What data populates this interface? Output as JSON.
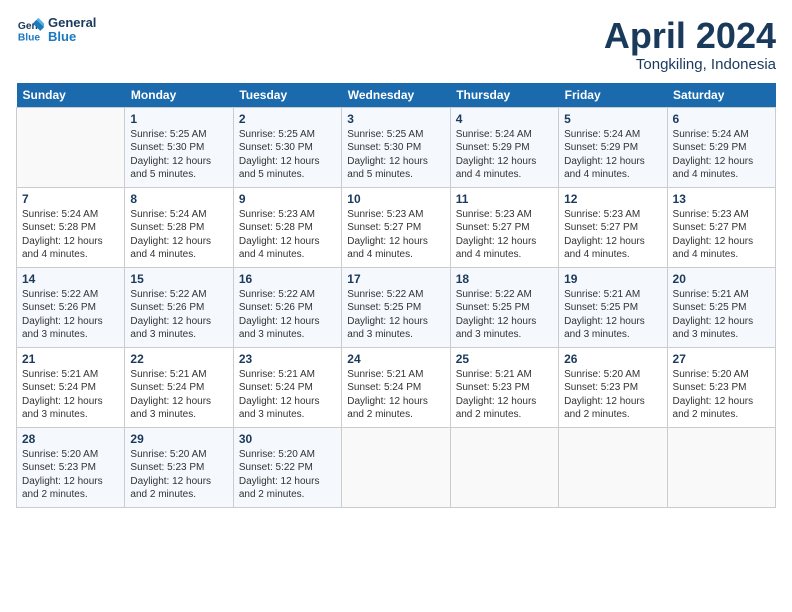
{
  "header": {
    "logo_line1": "General",
    "logo_line2": "Blue",
    "month_title": "April 2024",
    "location": "Tongkiling, Indonesia"
  },
  "days_of_week": [
    "Sunday",
    "Monday",
    "Tuesday",
    "Wednesday",
    "Thursday",
    "Friday",
    "Saturday"
  ],
  "weeks": [
    [
      {
        "day": "",
        "info": ""
      },
      {
        "day": "1",
        "info": "Sunrise: 5:25 AM\nSunset: 5:30 PM\nDaylight: 12 hours\nand 5 minutes."
      },
      {
        "day": "2",
        "info": "Sunrise: 5:25 AM\nSunset: 5:30 PM\nDaylight: 12 hours\nand 5 minutes."
      },
      {
        "day": "3",
        "info": "Sunrise: 5:25 AM\nSunset: 5:30 PM\nDaylight: 12 hours\nand 5 minutes."
      },
      {
        "day": "4",
        "info": "Sunrise: 5:24 AM\nSunset: 5:29 PM\nDaylight: 12 hours\nand 4 minutes."
      },
      {
        "day": "5",
        "info": "Sunrise: 5:24 AM\nSunset: 5:29 PM\nDaylight: 12 hours\nand 4 minutes."
      },
      {
        "day": "6",
        "info": "Sunrise: 5:24 AM\nSunset: 5:29 PM\nDaylight: 12 hours\nand 4 minutes."
      }
    ],
    [
      {
        "day": "7",
        "info": "Sunrise: 5:24 AM\nSunset: 5:28 PM\nDaylight: 12 hours\nand 4 minutes."
      },
      {
        "day": "8",
        "info": "Sunrise: 5:24 AM\nSunset: 5:28 PM\nDaylight: 12 hours\nand 4 minutes."
      },
      {
        "day": "9",
        "info": "Sunrise: 5:23 AM\nSunset: 5:28 PM\nDaylight: 12 hours\nand 4 minutes."
      },
      {
        "day": "10",
        "info": "Sunrise: 5:23 AM\nSunset: 5:27 PM\nDaylight: 12 hours\nand 4 minutes."
      },
      {
        "day": "11",
        "info": "Sunrise: 5:23 AM\nSunset: 5:27 PM\nDaylight: 12 hours\nand 4 minutes."
      },
      {
        "day": "12",
        "info": "Sunrise: 5:23 AM\nSunset: 5:27 PM\nDaylight: 12 hours\nand 4 minutes."
      },
      {
        "day": "13",
        "info": "Sunrise: 5:23 AM\nSunset: 5:27 PM\nDaylight: 12 hours\nand 4 minutes."
      }
    ],
    [
      {
        "day": "14",
        "info": "Sunrise: 5:22 AM\nSunset: 5:26 PM\nDaylight: 12 hours\nand 3 minutes."
      },
      {
        "day": "15",
        "info": "Sunrise: 5:22 AM\nSunset: 5:26 PM\nDaylight: 12 hours\nand 3 minutes."
      },
      {
        "day": "16",
        "info": "Sunrise: 5:22 AM\nSunset: 5:26 PM\nDaylight: 12 hours\nand 3 minutes."
      },
      {
        "day": "17",
        "info": "Sunrise: 5:22 AM\nSunset: 5:25 PM\nDaylight: 12 hours\nand 3 minutes."
      },
      {
        "day": "18",
        "info": "Sunrise: 5:22 AM\nSunset: 5:25 PM\nDaylight: 12 hours\nand 3 minutes."
      },
      {
        "day": "19",
        "info": "Sunrise: 5:21 AM\nSunset: 5:25 PM\nDaylight: 12 hours\nand 3 minutes."
      },
      {
        "day": "20",
        "info": "Sunrise: 5:21 AM\nSunset: 5:25 PM\nDaylight: 12 hours\nand 3 minutes."
      }
    ],
    [
      {
        "day": "21",
        "info": "Sunrise: 5:21 AM\nSunset: 5:24 PM\nDaylight: 12 hours\nand 3 minutes."
      },
      {
        "day": "22",
        "info": "Sunrise: 5:21 AM\nSunset: 5:24 PM\nDaylight: 12 hours\nand 3 minutes."
      },
      {
        "day": "23",
        "info": "Sunrise: 5:21 AM\nSunset: 5:24 PM\nDaylight: 12 hours\nand 3 minutes."
      },
      {
        "day": "24",
        "info": "Sunrise: 5:21 AM\nSunset: 5:24 PM\nDaylight: 12 hours\nand 2 minutes."
      },
      {
        "day": "25",
        "info": "Sunrise: 5:21 AM\nSunset: 5:23 PM\nDaylight: 12 hours\nand 2 minutes."
      },
      {
        "day": "26",
        "info": "Sunrise: 5:20 AM\nSunset: 5:23 PM\nDaylight: 12 hours\nand 2 minutes."
      },
      {
        "day": "27",
        "info": "Sunrise: 5:20 AM\nSunset: 5:23 PM\nDaylight: 12 hours\nand 2 minutes."
      }
    ],
    [
      {
        "day": "28",
        "info": "Sunrise: 5:20 AM\nSunset: 5:23 PM\nDaylight: 12 hours\nand 2 minutes."
      },
      {
        "day": "29",
        "info": "Sunrise: 5:20 AM\nSunset: 5:23 PM\nDaylight: 12 hours\nand 2 minutes."
      },
      {
        "day": "30",
        "info": "Sunrise: 5:20 AM\nSunset: 5:22 PM\nDaylight: 12 hours\nand 2 minutes."
      },
      {
        "day": "",
        "info": ""
      },
      {
        "day": "",
        "info": ""
      },
      {
        "day": "",
        "info": ""
      },
      {
        "day": "",
        "info": ""
      }
    ]
  ]
}
